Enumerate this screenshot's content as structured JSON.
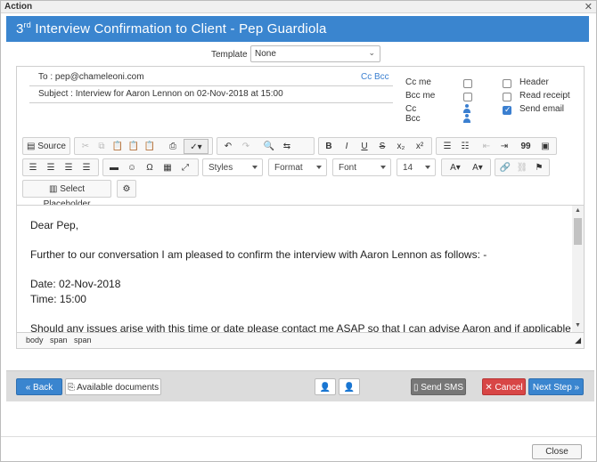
{
  "window": {
    "title": "Action",
    "close_glyph": "✕"
  },
  "header": {
    "title_pre": "3",
    "title_sup": "rd",
    "title_rest": " Interview Confirmation to Client - Pep Guardiola",
    "color": "#3a85cf"
  },
  "template": {
    "label": "Template",
    "value": "None"
  },
  "email": {
    "to": "To :  pep@chameleoni.com",
    "cc_bcc_link": "Cc Bcc",
    "subject": "Subject :  Interview for Aaron Lennon on 02-Nov-2018 at 15:00"
  },
  "options": {
    "cc_me": {
      "label": "Cc me",
      "checked": false
    },
    "bcc_me": {
      "label": "Bcc me",
      "checked": false
    },
    "cc": {
      "label": "Cc"
    },
    "bcc": {
      "label": "Bcc"
    },
    "header": {
      "label": "Header",
      "checked": false
    },
    "read_receipt": {
      "label": "Read receipt",
      "checked": false
    },
    "send_email": {
      "label": "Send email",
      "checked": true
    }
  },
  "toolbar": {
    "source": "Source",
    "styles": "Styles",
    "format": "Format",
    "font": "Font",
    "size": "14",
    "select_placeholder": "Select Placeholder",
    "bold": "B",
    "italic": "I",
    "underline": "U",
    "strike": "S",
    "subscript": "x₂",
    "superscript": "x²",
    "blockquote": "99",
    "omega": "Ω"
  },
  "editor": {
    "lines": [
      "Dear Pep,",
      "Further to our conversation I am pleased to confirm the interview with Aaron Lennon as follows: -",
      "Date: 02-Nov-2018",
      "Time: 15:00",
      "Should any issues arise with this time or date please contact me ASAP so that I can advise Aaron and if applicable re-schedule"
    ]
  },
  "path_bar": [
    "body",
    "span",
    "span"
  ],
  "footer": {
    "back": "« Back",
    "available_documents": "Available documents",
    "send_sms": "Send SMS",
    "cancel": "Cancel",
    "next_step": "Next Step »"
  },
  "close": "Close",
  "colors": {
    "accent": "#3a85cf",
    "danger": "#d84646",
    "sms": "#777777"
  }
}
